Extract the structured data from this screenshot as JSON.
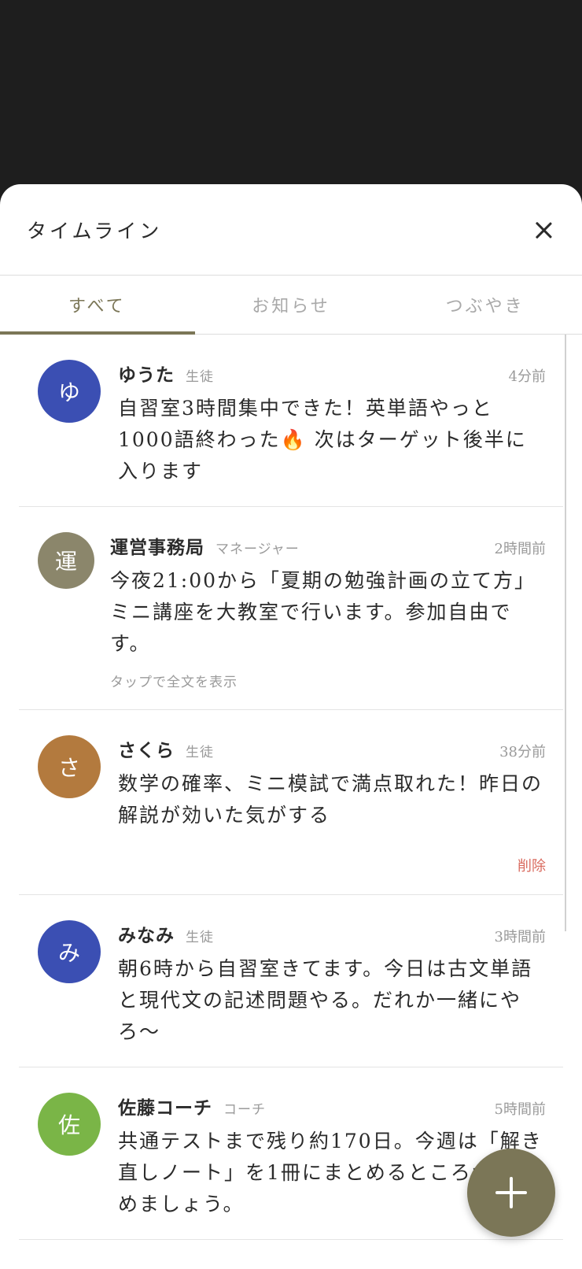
{
  "header": {
    "title": "タイムライン",
    "close_icon": "close-icon"
  },
  "tabs": [
    {
      "label": "すべて",
      "active": true
    },
    {
      "label": "お知らせ",
      "active": false
    },
    {
      "label": "つぶやき",
      "active": false
    }
  ],
  "colors": {
    "accent": "#7b7657",
    "backdrop": "#1e1e1e",
    "delete": "#d96a5e"
  },
  "posts": [
    {
      "avatar_char": "ゆ",
      "avatar_color": "#3b4fb3",
      "name": "ゆうた",
      "role": "生徒",
      "time": "4分前",
      "text": "自習室3時間集中できた！英単語やっと1000語終わった🔥 次はターゲット後半に入ります"
    },
    {
      "avatar_char": "運",
      "avatar_color": "#8b866b",
      "name": "運営事務局",
      "role": "マネージャー",
      "time": "2時間前",
      "text": "今夜21:00から「夏期の勉強計画の立て方」ミニ講座を大教室で行います。参加自由です。",
      "hint": "タップで全文を表示"
    },
    {
      "avatar_char": "さ",
      "avatar_color": "#b37a3e",
      "name": "さくら",
      "role": "生徒",
      "time": "38分前",
      "text": "数学の確率、ミニ模試で満点取れた！昨日の解説が効いた気がする",
      "delete_label": "削除"
    },
    {
      "avatar_char": "み",
      "avatar_color": "#3b4fb3",
      "name": "みなみ",
      "role": "生徒",
      "time": "3時間前",
      "text": "朝6時から自習室きてます。今日は古文単語と現代文の記述問題やる。だれか一緒にやろ〜"
    },
    {
      "avatar_char": "佐",
      "avatar_color": "#7ab547",
      "name": "佐藤コーチ",
      "role": "コーチ",
      "time": "5時間前",
      "text": "共通テストまで残り約170日。今週は「解き直しノート」を1冊にまとめるところから始めましょう。"
    }
  ],
  "fab": {
    "icon": "plus-icon"
  }
}
